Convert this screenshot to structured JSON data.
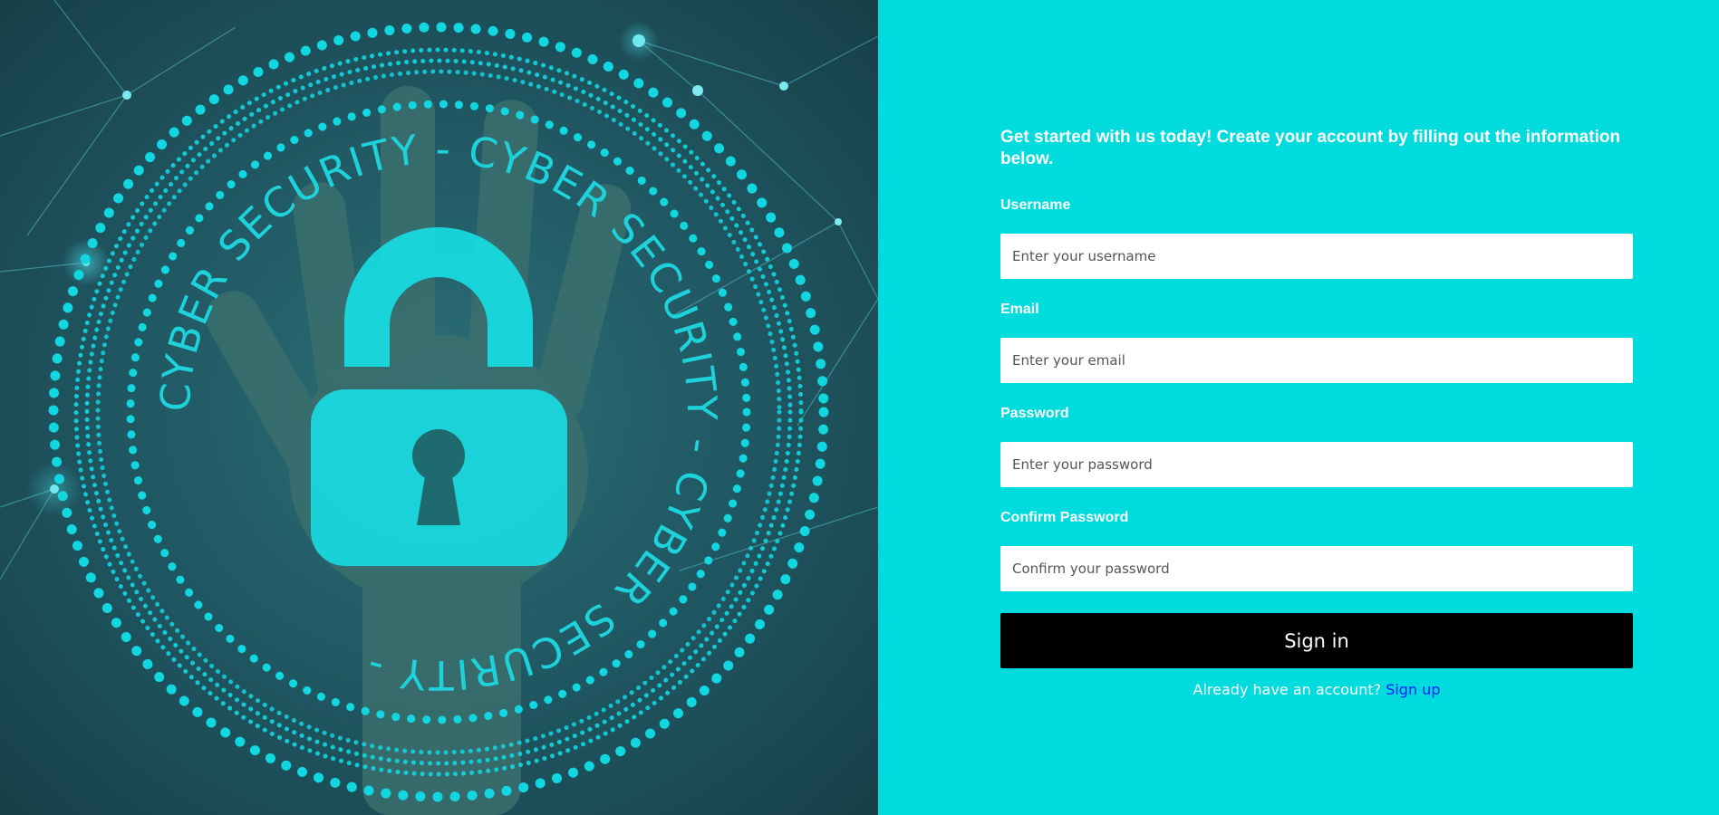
{
  "hero": {
    "ring_text": "CYBER SECURITY - CYBER SECURITY - CYBER SECURITY - ",
    "icon": "padlock-icon"
  },
  "form": {
    "intro": "Get started with us today! Create your account by filling out the information below.",
    "username_label": "Username",
    "username_placeholder": "Enter your username",
    "email_label": "Email",
    "email_placeholder": "Enter your email",
    "password_label": "Password",
    "password_placeholder": "Enter your password",
    "confirm_label": "Confirm Password",
    "confirm_placeholder": "Confirm your password",
    "submit_label": "Sign in",
    "footer_text": "Already have an account?",
    "footer_link": "Sign up"
  },
  "colors": {
    "panel_bg": "#00dbde",
    "hero_bg": "#1f5560",
    "accent_cyan": "#12d6e0",
    "button_bg": "#000000",
    "link": "#1a1aff"
  }
}
